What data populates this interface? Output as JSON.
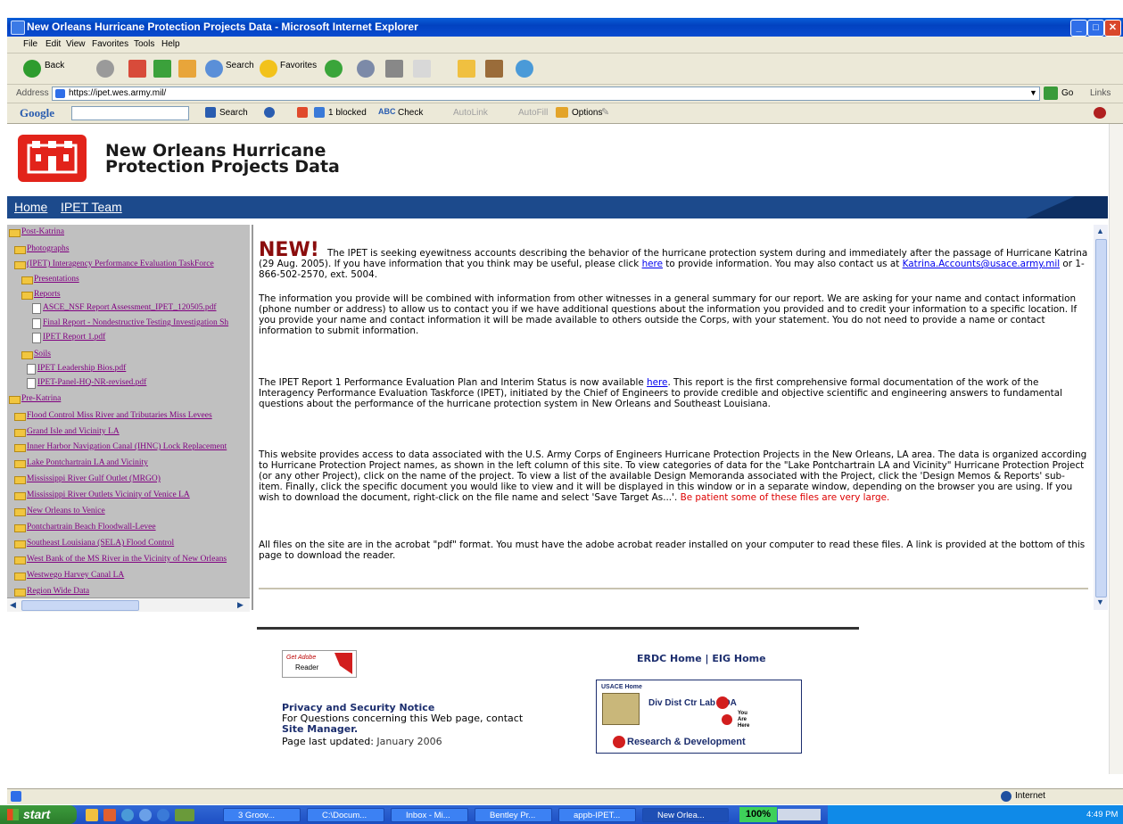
{
  "window": {
    "title": "New Orleans Hurricane Protection Projects Data - Microsoft Internet Explorer",
    "menu": [
      "File",
      "Edit",
      "View",
      "Favorites",
      "Tools",
      "Help"
    ]
  },
  "toolbar": {
    "back": "Back",
    "search": "Search",
    "favorites": "Favorites"
  },
  "address": {
    "label": "Address",
    "url": "https://ipet.wes.army.mil/",
    "go": "Go",
    "links": "Links"
  },
  "google": {
    "logo": "Google",
    "search": "Search",
    "blocked": "1 blocked",
    "check": "Check",
    "autolink": "AutoLink",
    "autofill": "AutoFill",
    "options": "Options"
  },
  "site": {
    "title_line1": "New Orleans Hurricane",
    "title_line2": "Protection Projects Data",
    "nav": [
      "Home",
      "IPET Team"
    ]
  },
  "tree": [
    {
      "label": "Post-Katrina",
      "type": "folder-open",
      "depth": 0
    },
    {
      "label": "Photographs",
      "type": "folder",
      "depth": 1
    },
    {
      "label": "(IPET) Interagency Performance Evaluation TaskForce",
      "type": "folder-open",
      "depth": 1
    },
    {
      "label": "Presentations",
      "type": "folder",
      "depth": 2
    },
    {
      "label": "Reports",
      "type": "folder-open",
      "depth": 2
    },
    {
      "label": "ASCE_NSF Report Assessment_IPET_120505.pdf",
      "type": "doc",
      "depth": 3
    },
    {
      "label": "Final Report - Nondestructive Testing Investigation Sh",
      "type": "doc",
      "depth": 3
    },
    {
      "label": "IPET Report 1.pdf",
      "type": "doc",
      "depth": 3
    },
    {
      "label": "Soils",
      "type": "folder",
      "depth": 2
    },
    {
      "label": "IPET Leadership Bios.pdf",
      "type": "doc",
      "depth": 2
    },
    {
      "label": "IPET-Panel-HQ-NR-revised.pdf",
      "type": "doc",
      "depth": 2
    },
    {
      "label": "Pre-Katrina",
      "type": "folder-open",
      "depth": 0
    },
    {
      "label": "Flood Control Miss River and Tributaries Miss Levees",
      "type": "folder",
      "depth": 1
    },
    {
      "label": "Grand Isle and Vicinity LA",
      "type": "folder",
      "depth": 1
    },
    {
      "label": "Inner Harbor Navigation Canal (IHNC) Lock Replacement",
      "type": "folder",
      "depth": 1
    },
    {
      "label": "Lake Pontchartrain LA and Vicinity",
      "type": "folder",
      "depth": 1
    },
    {
      "label": "Mississippi River Gulf Outlet (MRGO)",
      "type": "folder",
      "depth": 1
    },
    {
      "label": "Mississippi River Outlets Vicinity of Venice LA",
      "type": "folder",
      "depth": 1
    },
    {
      "label": "New Orleans to Venice",
      "type": "folder",
      "depth": 1
    },
    {
      "label": "Pontchartrain Beach Floodwall-Levee",
      "type": "folder",
      "depth": 1
    },
    {
      "label": "Southeast Louisiana (SELA) Flood Control",
      "type": "folder",
      "depth": 1
    },
    {
      "label": "West Bank of the MS River in the Vicinity of New Orleans",
      "type": "folder",
      "depth": 1
    },
    {
      "label": "Westwego Harvey Canal LA",
      "type": "folder",
      "depth": 1
    },
    {
      "label": "Region Wide Data",
      "type": "folder",
      "depth": 1
    }
  ],
  "content": {
    "new_tag": "NEW!",
    "p1_a": "The IPET is seeking eyewitness accounts describing the behavior of the hurricane protection system during and immediately after the passage of Hurricane Katrina (29 Aug. 2005). If you have information that you think may be useful, please click ",
    "p1_link": "here",
    "p1_b": " to provide information. You may also contact us at ",
    "p1_email": "Katrina.Accounts@usace.army.mil",
    "p1_c": " or 1-866-502-2570, ext. 5004.",
    "p2": "The information you provide will be combined with information from other witnesses in a general summary for our report. We are asking for your name and contact information (phone number or address) to allow us to contact you if we have additional questions about the information you provided and to credit your information to a specific location. If you provide your name and contact information it will be made available to others outside the Corps, with your statement. You do not need to provide a name or contact information to submit information.",
    "p3_a": "The IPET Report 1 Performance Evaluation Plan and Interim Status is now available ",
    "p3_link": "here",
    "p3_b": ". This report is the first comprehensive formal documentation of the work of the Interagency Performance Evaluation Taskforce (IPET), initiated by the Chief of Engineers to provide credible and objective scientific and engineering answers to fundamental questions about the performance of the hurricane protection system in New Orleans and Southeast Louisiana.",
    "p4_a": "This website provides access to data associated with the U.S. Army Corps of Engineers Hurricane Protection Projects in the New Orleans, LA area. The data is organized according to Hurricane Protection Project names, as shown in the left column of this site. To view categories of data for the \"Lake Pontchartrain LA and Vicinity\" Hurricane Protection Project (or any other Project), click on the name of the project. To view a list of the available Design Memoranda associated with the Project, click the 'Design Memos & Reports' sub-item. Finally, click the specific document you would like to view and it will be displayed in this window or in a separate window, depending on the browser you are using. If you wish to download the document, right-click on the file name and select 'Save Target As...'. ",
    "p4_red": "Be patient some of these files are very large.",
    "p5": "All files on the site are in the acrobat \"pdf\" format.  You must have the adobe acrobat reader installed on your computer to read these files.  A link is provided at the bottom of this page to download the reader."
  },
  "footer": {
    "adobe_get": "Get Adobe",
    "adobe_reader": "Reader",
    "privacy": "Privacy and Security Notice",
    "questions": "For Questions concerning this Web page, contact",
    "site_manager": "Site Manager.",
    "updated_label": "Page last updated:",
    "updated_value": "January 2006",
    "erdc_home": "ERDC Home",
    "sep": "|",
    "eig_home": "EIG Home",
    "usace_home": "USACE Home",
    "div_line": "Div Dist Ctr Lab FOA",
    "you_are_here": "You Are Here",
    "rd": "Research & Development"
  },
  "status": {
    "zone": "Internet"
  },
  "taskbar": {
    "start": "start",
    "tasks": [
      "3 Groov...",
      "C:\\Docum...",
      "Inbox - Mi...",
      "Bentley Pr...",
      "appb-IPET...",
      "New Orlea..."
    ],
    "zoom": "100%",
    "clock": "4:49 PM"
  },
  "colors": {
    "nav_blue": "#1c4a8c",
    "corps_red": "#e2231a",
    "link_visited": "#800080",
    "alert_red": "#dd0000"
  }
}
